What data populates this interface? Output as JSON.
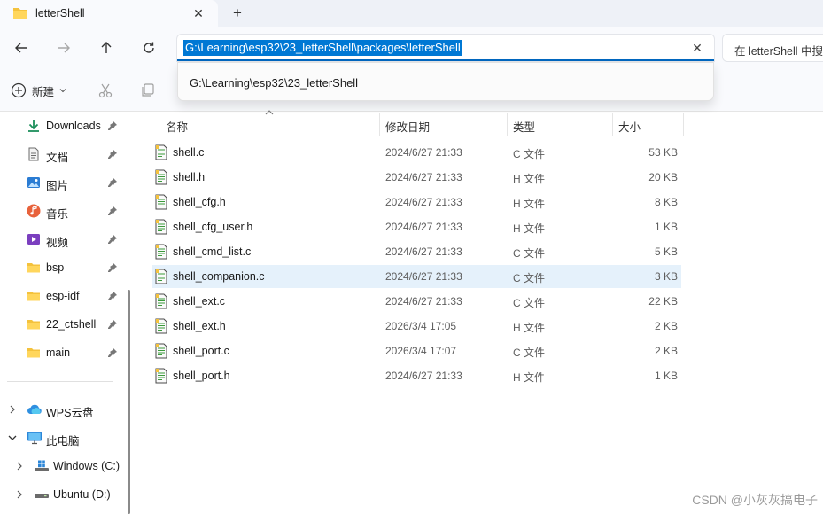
{
  "window": {
    "tab_title": "letterShell",
    "new_tab_glyph": "+",
    "close_glyph": "✕"
  },
  "nav": {
    "address_value": "G:\\Learning\\esp32\\23_letterShell\\packages\\letterShell",
    "search_placeholder": "在 letterShell 中搜索",
    "clear_glyph": "✕"
  },
  "suggest": {
    "items": [
      "G:\\Learning\\esp32\\23_letterShell"
    ]
  },
  "toolbar": {
    "new_label": "新建"
  },
  "sidebar": {
    "quick_access": [
      {
        "label": "Downloads",
        "icon": "download-icon"
      },
      {
        "label": "文档",
        "icon": "document-icon"
      },
      {
        "label": "图片",
        "icon": "picture-icon"
      },
      {
        "label": "音乐",
        "icon": "music-icon"
      },
      {
        "label": "视频",
        "icon": "video-icon"
      },
      {
        "label": "bsp",
        "icon": "folder-icon"
      },
      {
        "label": "esp-idf",
        "icon": "folder-icon"
      },
      {
        "label": "22_ctshell",
        "icon": "folder-icon"
      },
      {
        "label": "main",
        "icon": "folder-icon"
      }
    ],
    "tree": [
      {
        "label": "WPS云盘",
        "icon": "cloud-icon"
      },
      {
        "label": "此电脑",
        "icon": "computer-icon"
      },
      {
        "label": "Windows (C:)",
        "icon": "windows-drive-icon"
      },
      {
        "label": "Ubuntu (D:)",
        "icon": "drive-icon"
      }
    ]
  },
  "columns": {
    "name": "名称",
    "modified": "修改日期",
    "type": "类型",
    "size": "大小"
  },
  "files": [
    {
      "name": "shell.c",
      "modified": "2024/6/27 21:33",
      "type": "C 文件",
      "size": "53 KB"
    },
    {
      "name": "shell.h",
      "modified": "2024/6/27 21:33",
      "type": "H 文件",
      "size": "20 KB"
    },
    {
      "name": "shell_cfg.h",
      "modified": "2024/6/27 21:33",
      "type": "H 文件",
      "size": "8 KB"
    },
    {
      "name": "shell_cfg_user.h",
      "modified": "2024/6/27 21:33",
      "type": "H 文件",
      "size": "1 KB"
    },
    {
      "name": "shell_cmd_list.c",
      "modified": "2024/6/27 21:33",
      "type": "C 文件",
      "size": "5 KB"
    },
    {
      "name": "shell_companion.c",
      "modified": "2024/6/27 21:33",
      "type": "C 文件",
      "size": "3 KB"
    },
    {
      "name": "shell_ext.c",
      "modified": "2024/6/27 21:33",
      "type": "C 文件",
      "size": "22 KB"
    },
    {
      "name": "shell_ext.h",
      "modified": "2026/3/4 17:05",
      "type": "H 文件",
      "size": "2 KB"
    },
    {
      "name": "shell_port.c",
      "modified": "2026/3/4 17:07",
      "type": "C 文件",
      "size": "2 KB"
    },
    {
      "name": "shell_port.h",
      "modified": "2024/6/27 21:33",
      "type": "H 文件",
      "size": "1 KB"
    }
  ],
  "selected_index": 5,
  "watermark": "CSDN @小灰灰搞电子",
  "colors": {
    "accent": "#0067c0",
    "selection": "#0078d4",
    "row_hover": "#e5f1fb",
    "folder": "#f4c23d"
  }
}
